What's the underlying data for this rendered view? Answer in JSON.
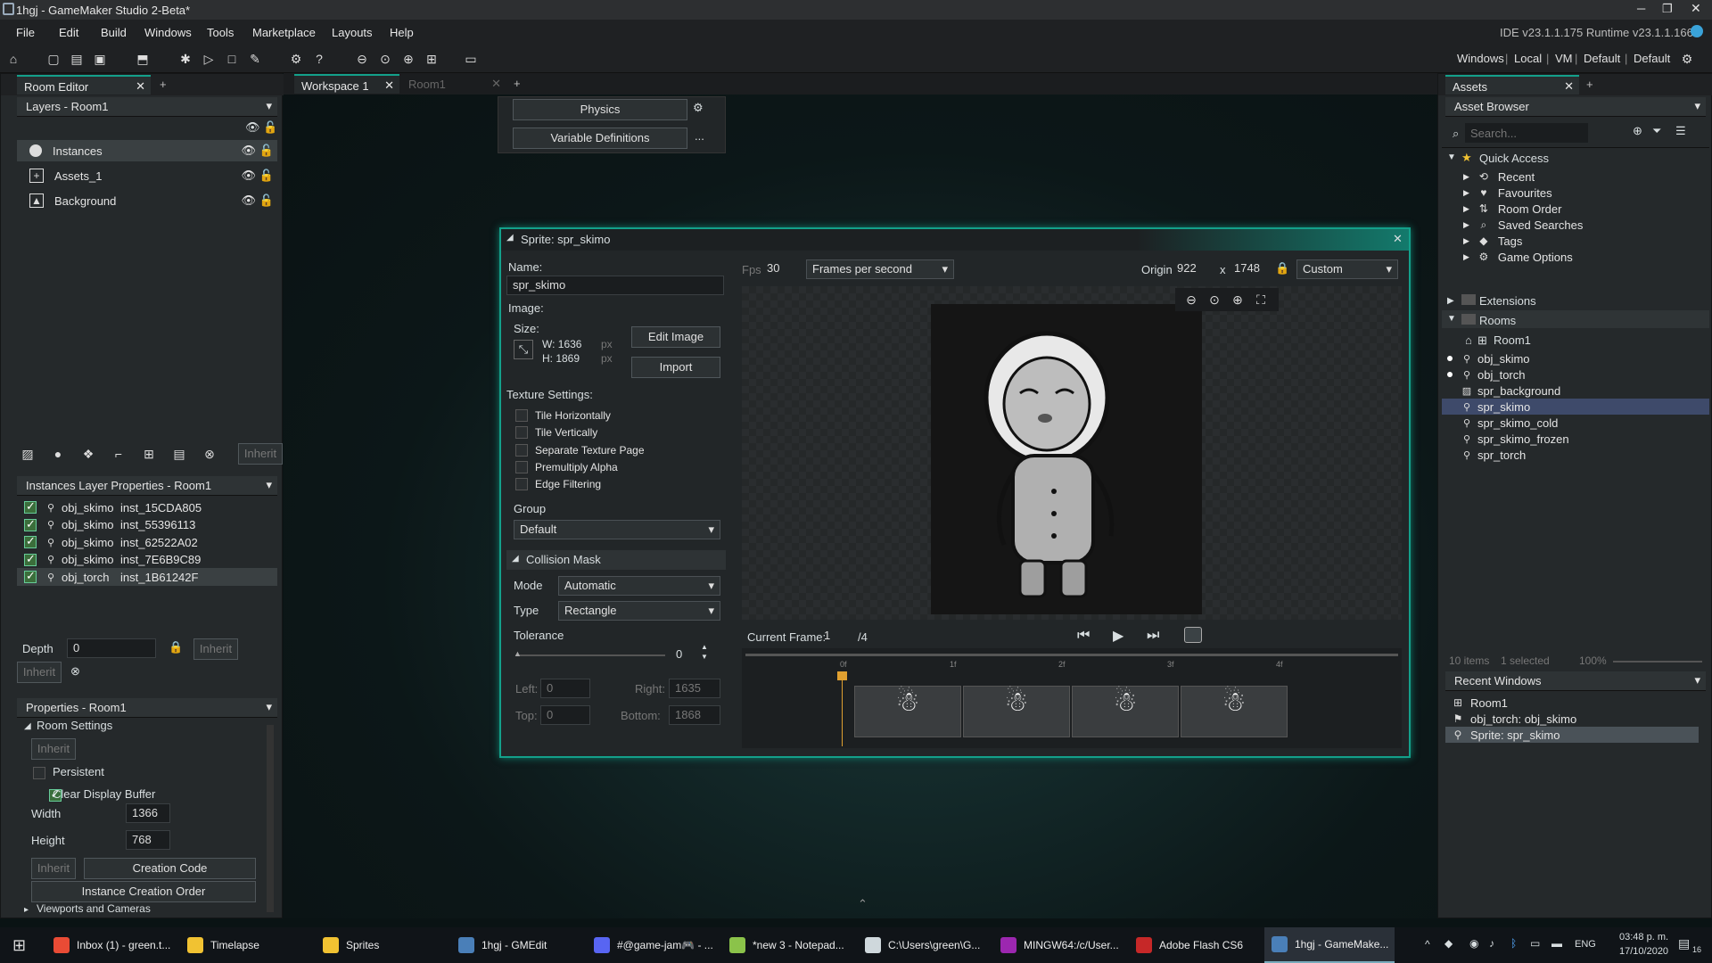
{
  "window": {
    "title": "1hgj - GameMaker Studio 2-Beta*"
  },
  "menu": [
    "File",
    "Edit",
    "Build",
    "Windows",
    "Tools",
    "Marketplace",
    "Layouts",
    "Help"
  ],
  "ide_version": "IDE v23.1.1.175  Runtime v23.1.1.166",
  "toolbar_right": {
    "windows": "Windows",
    "local": "Local",
    "vm": "VM",
    "default1": "Default",
    "default2": "Default"
  },
  "room_editor": {
    "tab": "Room Editor",
    "layers_title": "Layers - Room1",
    "layers": [
      {
        "name": "Instances",
        "icon": "instances-icon"
      },
      {
        "name": "Assets_1",
        "icon": "assets-layer-icon"
      },
      {
        "name": "Background",
        "icon": "background-icon"
      }
    ],
    "inherit_label": "Inherit",
    "instances_props_title": "Instances Layer Properties - Room1",
    "instances": [
      {
        "object": "obj_skimo",
        "id": "inst_15CDA805"
      },
      {
        "object": "obj_skimo",
        "id": "inst_55396113"
      },
      {
        "object": "obj_skimo",
        "id": "inst_62522A02"
      },
      {
        "object": "obj_skimo",
        "id": "inst_7E6B9C89"
      },
      {
        "object": "obj_torch",
        "id": "inst_1B61242F"
      }
    ],
    "depth_label": "Depth",
    "depth_value": "0",
    "inherit_btn": "Inherit",
    "properties_title": "Properties - Room1",
    "room_settings": "Room Settings",
    "persistent": "Persistent",
    "clear_display_buffer": "Clear Display Buffer",
    "width_label": "Width",
    "width_value": "1366",
    "height_label": "Height",
    "height_value": "768",
    "creation_code": "Creation Code",
    "instance_creation_order": "Instance Creation Order",
    "viewports": "Viewports and Cameras"
  },
  "workspace": {
    "tabs": [
      {
        "label": "Workspace 1"
      },
      {
        "label": "Room1"
      }
    ],
    "physics": "Physics",
    "variable_definitions": "Variable Definitions",
    "ellipsis": "..."
  },
  "sprite_editor": {
    "title": "Sprite: spr_skimo",
    "name_label": "Name:",
    "name_value": "spr_skimo",
    "image_label": "Image:",
    "size_label": "Size:",
    "width": "W: 1636",
    "height": "H: 1869",
    "px": "px",
    "edit_image": "Edit Image",
    "import": "Import",
    "texture_settings": "Texture Settings:",
    "texture_options": [
      {
        "label": "Tile Horizontally",
        "checked": false
      },
      {
        "label": "Tile Vertically",
        "checked": false
      },
      {
        "label": "Separate Texture Page",
        "checked": false
      },
      {
        "label": "Premultiply Alpha",
        "checked": false
      },
      {
        "label": "Edge Filtering",
        "checked": false
      }
    ],
    "group_label": "Group",
    "group_value": "Default",
    "collision_mask": "Collision Mask",
    "mode_label": "Mode",
    "mode_value": "Automatic",
    "type_label": "Type",
    "type_value": "Rectangle",
    "tolerance_label": "Tolerance",
    "tolerance_value": "0",
    "left_label": "Left:",
    "left_value": "0",
    "right_label": "Right:",
    "right_value": "1635",
    "top_label": "Top:",
    "top_value": "0",
    "bottom_label": "Bottom:",
    "bottom_value": "1868",
    "fps_label": "Fps",
    "fps_value": "30",
    "fps_mode": "Frames per second",
    "origin_label": "Origin",
    "origin_x": "922",
    "origin_sep": "x",
    "origin_y": "1748",
    "origin_preset": "Custom",
    "current_frame_label": "Current Frame:",
    "current_frame_value": "1",
    "frame_total": "/4",
    "timeline_marks": [
      "0f",
      "1f",
      "2f",
      "3f",
      "4f"
    ]
  },
  "assets": {
    "tab": "Assets",
    "browser": "Asset Browser",
    "search_placeholder": "Search...",
    "quick_access": "Quick Access",
    "quick_items": [
      {
        "label": "Recent",
        "icon": "recent-icon"
      },
      {
        "label": "Favourites",
        "icon": "heart-icon"
      },
      {
        "label": "Room Order",
        "icon": "room-order-icon"
      },
      {
        "label": "Saved Searches",
        "icon": "search-icon"
      },
      {
        "label": "Tags",
        "icon": "tag-icon"
      },
      {
        "label": "Game Options",
        "icon": "gear-icon"
      }
    ],
    "extensions": "Extensions",
    "rooms": "Rooms",
    "room1": "Room1",
    "items": [
      {
        "label": "obj_skimo",
        "dot": true
      },
      {
        "label": "obj_torch",
        "dot": true
      },
      {
        "label": "spr_background",
        "dot": false
      },
      {
        "label": "spr_skimo",
        "dot": false
      },
      {
        "label": "spr_skimo_cold",
        "dot": false
      },
      {
        "label": "spr_skimo_frozen",
        "dot": false
      },
      {
        "label": "spr_torch",
        "dot": false
      }
    ],
    "status_items": "10 items",
    "status_selected": "1 selected",
    "zoom": "100%",
    "recent_windows": "Recent Windows",
    "recent": [
      {
        "label": "Room1"
      },
      {
        "label": "obj_torch: obj_skimo"
      },
      {
        "label": "Sprite: spr_skimo"
      }
    ]
  },
  "taskbar": {
    "items": [
      {
        "label": "Inbox (1) - green.t...",
        "color": "#e94b35"
      },
      {
        "label": "Timelapse",
        "color": "#f1c232"
      },
      {
        "label": "Sprites",
        "color": "#f1c232"
      },
      {
        "label": "1hgj - GMEdit",
        "color": "#4a7fb8"
      },
      {
        "label": "#@game-jam🎮 - ...",
        "color": "#5865f2"
      },
      {
        "label": "*new 3 - Notepad...",
        "color": "#8bc34a"
      },
      {
        "label": "C:\\Users\\green\\G...",
        "color": "#cfd8dc"
      },
      {
        "label": "MINGW64:/c/User...",
        "color": "#9c27b0"
      },
      {
        "label": "Adobe Flash CS6",
        "color": "#c62828"
      },
      {
        "label": "1hgj - GameMake...",
        "color": "#4a7fb8"
      }
    ],
    "lang": "ENG",
    "time": "03:48 p. m.",
    "date": "17/10/2020",
    "notif": "16"
  }
}
